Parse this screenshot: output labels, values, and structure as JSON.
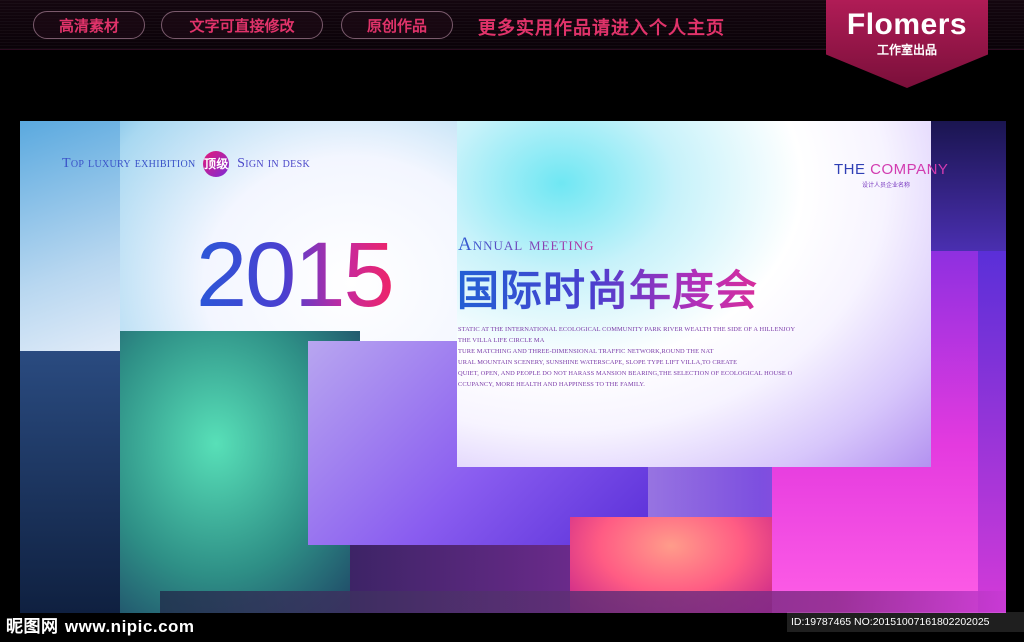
{
  "top_bar": {
    "pills": [
      "高清素材",
      "文字可直接修改",
      "原创作品"
    ],
    "promo": "更多实用作品请进入个人主页",
    "logo": {
      "brand": "Flomers",
      "subtitle": "工作室出品"
    }
  },
  "artwork": {
    "tagline_left": "Top luxury exhibition",
    "badge": "顶级",
    "tagline_right": "Sign in desk",
    "company": {
      "part1": "THE ",
      "part2": "COMPANY",
      "sub": "设计人员企业名称"
    },
    "year": "2015",
    "subtitle_en": "Annual meeting",
    "title_cn": "国际时尚年度会",
    "paragraph_lines": [
      "STATIC AT THE INTERNATIONAL ECOLOGICAL COMMUNITY PARK RIVER WEALTH THE SIDE OF A HILLENJOY",
      "THE VILLA LIFE CIRCLE MA",
      "TURE MATCHING AND THREE-DIMENSIONAL TRAFFIC NETWORK,ROUND THE NAT",
      "URAL MOUNTAIN SCENERY, SUNSHINE WATERSCAPE, SLOPE TYPE LIFT VILLA,TO CREATE",
      "QUIET, OPEN, AND PEOPLE DO NOT HARASS MANSION BEARING,THE SELECTION OF ECOLOGICAL HOUSE O",
      "CCUPANCY, MORE HEALTH AND HAPPINESS TO THE FAMILY."
    ]
  },
  "watermark": {
    "logo_text": "昵图网",
    "site": "www.nipic.com",
    "id_text": "ID:19787465 NO:20151007161802202025"
  }
}
